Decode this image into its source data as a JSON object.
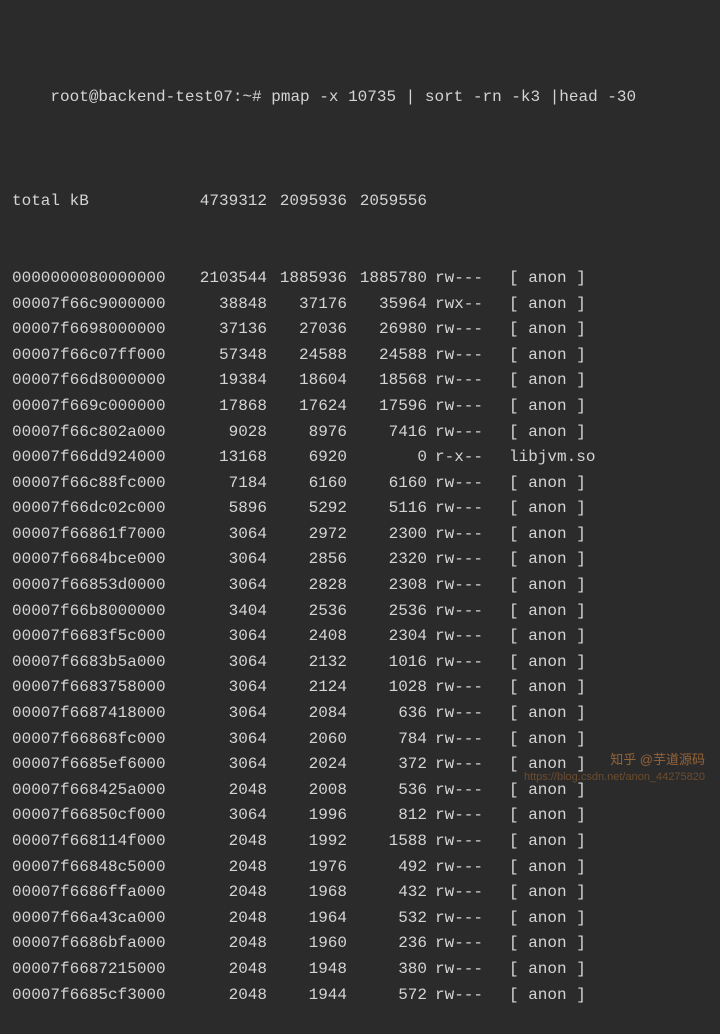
{
  "prompt": "root@backend-test07:~#",
  "command": "pmap -x 10735 | sort -rn -k3 |head -30",
  "total_label": "total kB",
  "total": {
    "kb": "4739312",
    "rss": "2095936",
    "dirty": "2059556"
  },
  "rows": [
    {
      "addr": "0000000080000000",
      "kb": "2103544",
      "rss": "1885936",
      "dirty": "1885780",
      "mode": "rw---",
      "map": "[ anon ]"
    },
    {
      "addr": "00007f66c9000000",
      "kb": "38848",
      "rss": "37176",
      "dirty": "35964",
      "mode": "rwx--",
      "map": "[ anon ]"
    },
    {
      "addr": "00007f6698000000",
      "kb": "37136",
      "rss": "27036",
      "dirty": "26980",
      "mode": "rw---",
      "map": "[ anon ]"
    },
    {
      "addr": "00007f66c07ff000",
      "kb": "57348",
      "rss": "24588",
      "dirty": "24588",
      "mode": "rw---",
      "map": "[ anon ]"
    },
    {
      "addr": "00007f66d8000000",
      "kb": "19384",
      "rss": "18604",
      "dirty": "18568",
      "mode": "rw---",
      "map": "[ anon ]"
    },
    {
      "addr": "00007f669c000000",
      "kb": "17868",
      "rss": "17624",
      "dirty": "17596",
      "mode": "rw---",
      "map": "[ anon ]"
    },
    {
      "addr": "00007f66c802a000",
      "kb": "9028",
      "rss": "8976",
      "dirty": "7416",
      "mode": "rw---",
      "map": "[ anon ]"
    },
    {
      "addr": "00007f66dd924000",
      "kb": "13168",
      "rss": "6920",
      "dirty": "0",
      "mode": "r-x--",
      "map": "libjvm.so"
    },
    {
      "addr": "00007f66c88fc000",
      "kb": "7184",
      "rss": "6160",
      "dirty": "6160",
      "mode": "rw---",
      "map": "[ anon ]"
    },
    {
      "addr": "00007f66dc02c000",
      "kb": "5896",
      "rss": "5292",
      "dirty": "5116",
      "mode": "rw---",
      "map": "[ anon ]"
    },
    {
      "addr": "00007f66861f7000",
      "kb": "3064",
      "rss": "2972",
      "dirty": "2300",
      "mode": "rw---",
      "map": "[ anon ]"
    },
    {
      "addr": "00007f6684bce000",
      "kb": "3064",
      "rss": "2856",
      "dirty": "2320",
      "mode": "rw---",
      "map": "[ anon ]"
    },
    {
      "addr": "00007f66853d0000",
      "kb": "3064",
      "rss": "2828",
      "dirty": "2308",
      "mode": "rw---",
      "map": "[ anon ]"
    },
    {
      "addr": "00007f66b8000000",
      "kb": "3404",
      "rss": "2536",
      "dirty": "2536",
      "mode": "rw---",
      "map": "[ anon ]"
    },
    {
      "addr": "00007f6683f5c000",
      "kb": "3064",
      "rss": "2408",
      "dirty": "2304",
      "mode": "rw---",
      "map": "[ anon ]"
    },
    {
      "addr": "00007f6683b5a000",
      "kb": "3064",
      "rss": "2132",
      "dirty": "1016",
      "mode": "rw---",
      "map": "[ anon ]"
    },
    {
      "addr": "00007f6683758000",
      "kb": "3064",
      "rss": "2124",
      "dirty": "1028",
      "mode": "rw---",
      "map": "[ anon ]"
    },
    {
      "addr": "00007f6687418000",
      "kb": "3064",
      "rss": "2084",
      "dirty": "636",
      "mode": "rw---",
      "map": "[ anon ]"
    },
    {
      "addr": "00007f66868fc000",
      "kb": "3064",
      "rss": "2060",
      "dirty": "784",
      "mode": "rw---",
      "map": "[ anon ]"
    },
    {
      "addr": "00007f6685ef6000",
      "kb": "3064",
      "rss": "2024",
      "dirty": "372",
      "mode": "rw---",
      "map": "[ anon ]"
    },
    {
      "addr": "00007f668425a000",
      "kb": "2048",
      "rss": "2008",
      "dirty": "536",
      "mode": "rw---",
      "map": "[ anon ]"
    },
    {
      "addr": "00007f66850cf000",
      "kb": "3064",
      "rss": "1996",
      "dirty": "812",
      "mode": "rw---",
      "map": "[ anon ]"
    },
    {
      "addr": "00007f668114f000",
      "kb": "2048",
      "rss": "1992",
      "dirty": "1588",
      "mode": "rw---",
      "map": "[ anon ]"
    },
    {
      "addr": "00007f66848c5000",
      "kb": "2048",
      "rss": "1976",
      "dirty": "492",
      "mode": "rw---",
      "map": "[ anon ]"
    },
    {
      "addr": "00007f6686ffa000",
      "kb": "2048",
      "rss": "1968",
      "dirty": "432",
      "mode": "rw---",
      "map": "[ anon ]"
    },
    {
      "addr": "00007f66a43ca000",
      "kb": "2048",
      "rss": "1964",
      "dirty": "532",
      "mode": "rw---",
      "map": "[ anon ]"
    },
    {
      "addr": "00007f6686bfa000",
      "kb": "2048",
      "rss": "1960",
      "dirty": "236",
      "mode": "rw---",
      "map": "[ anon ]"
    },
    {
      "addr": "00007f6687215000",
      "kb": "2048",
      "rss": "1948",
      "dirty": "380",
      "mode": "rw---",
      "map": "[ anon ]"
    },
    {
      "addr": "00007f6685cf3000",
      "kb": "2048",
      "rss": "1944",
      "dirty": "572",
      "mode": "rw---",
      "map": "[ anon ]"
    }
  ],
  "watermark": "知乎 @芋道源码",
  "watermark_sub": "https://blog.csdn.net/anon_44275820"
}
